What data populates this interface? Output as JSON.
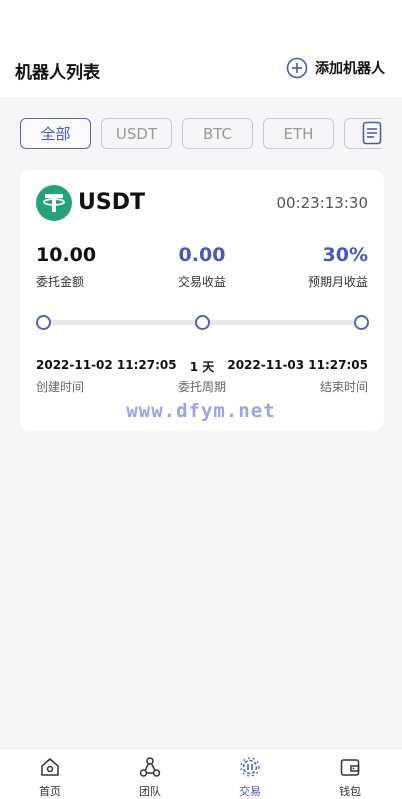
{
  "header": {
    "title": "机器人列表",
    "add_label": "添加机器人"
  },
  "filters": {
    "tabs": [
      "全部",
      "USDT",
      "BTC",
      "ETH"
    ],
    "active": "全部"
  },
  "robot_card": {
    "coin": "USDT",
    "countdown": "00:23:13:30",
    "amount": {
      "value": "10.00",
      "label": "委托金额"
    },
    "profit": {
      "value": "0.00",
      "label": "交易收益"
    },
    "monthly": {
      "value": "30%",
      "label": "预期月收益"
    },
    "progress_percent": 0,
    "start": {
      "value": "2022-11-02 11:27:05",
      "label": "创建时间"
    },
    "period": {
      "value": "1 天",
      "label": "委托周期"
    },
    "end": {
      "value": "2022-11-03 11:27:05",
      "label": "结束时间"
    }
  },
  "watermark": "www.dfym.net",
  "tabbar": {
    "items": [
      {
        "label": "首页",
        "icon": "home-icon"
      },
      {
        "label": "团队",
        "icon": "team-icon"
      },
      {
        "label": "交易",
        "icon": "trade-icon"
      },
      {
        "label": "钱包",
        "icon": "wallet-icon"
      }
    ],
    "active": "交易"
  },
  "colors": {
    "accent": "#4b57bd",
    "tether_green": "#26a17b",
    "background": "#f6f6f8"
  }
}
